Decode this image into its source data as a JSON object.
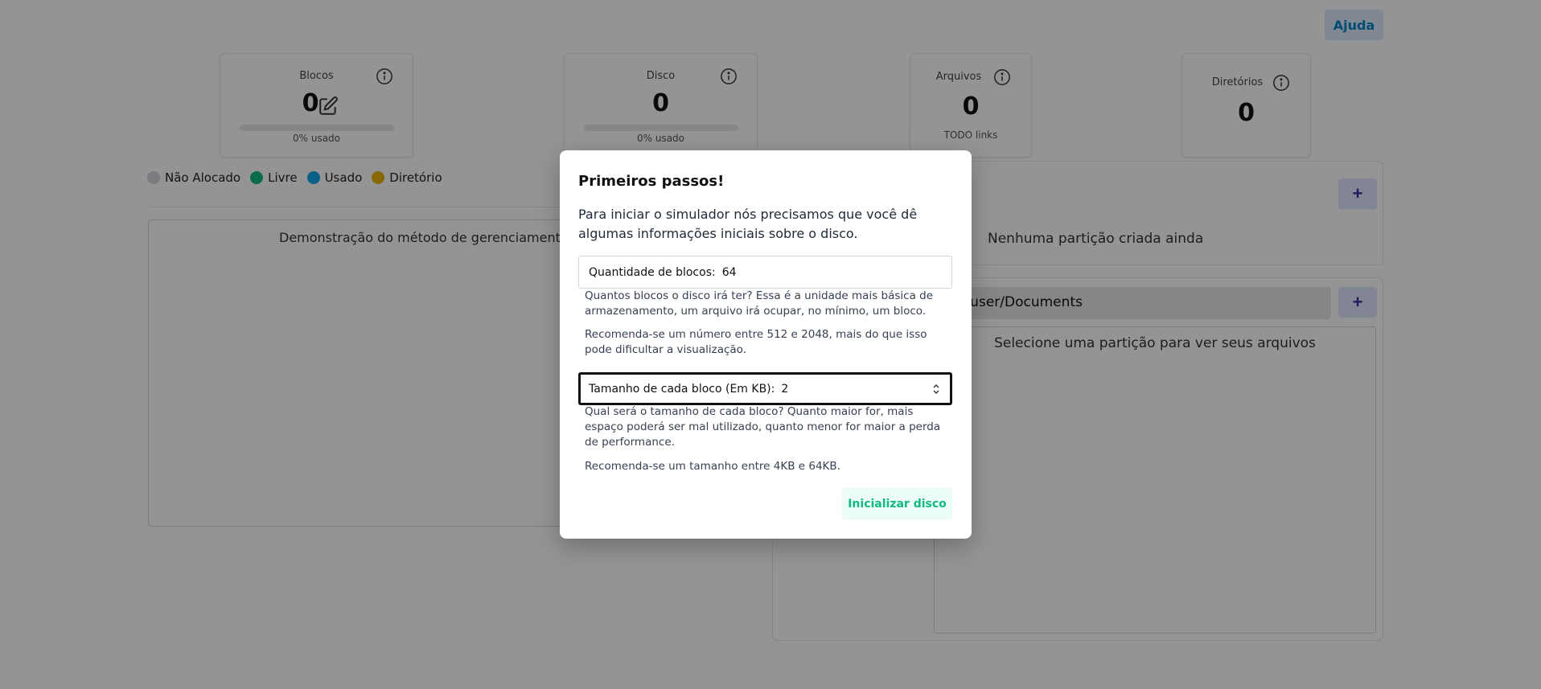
{
  "header": {
    "help_label": "Ajuda"
  },
  "stats": {
    "blocks": {
      "label": "Blocos",
      "value": "0",
      "sub": "0% usado",
      "usage_fraction": 0
    },
    "disk": {
      "label": "Disco",
      "value": "0",
      "sub": "0% usado",
      "usage_fraction": 0
    },
    "files": {
      "label": "Arquivos",
      "value": "0",
      "sub": "TODO links"
    },
    "dirs": {
      "label": "Diretórios",
      "value": "0"
    }
  },
  "legend": [
    {
      "label": "Não Alocado",
      "color": "#d1d5db"
    },
    {
      "label": "Livre",
      "color": "#10b981"
    },
    {
      "label": "Usado",
      "color": "#0ea5e9"
    },
    {
      "label": "Diretório",
      "color": "#eab308"
    }
  ],
  "demo": {
    "title": "Demonstração do método de gerenciamento de"
  },
  "partitions": {
    "empty_text": "Nenhuma partição criada ainda",
    "add_label": "+"
  },
  "files": {
    "path": "e/user/Documents",
    "add_label": "+",
    "empty_text": "Selecione uma partição para ver seus arquivos"
  },
  "modal": {
    "title": "Primeiros passos!",
    "intro": "Para iniciar o simulador nós precisamos que você dê algumas informações iniciais sobre o disco.",
    "blocks_field": {
      "label": "Quantidade de blocos:",
      "value": "64"
    },
    "blocks_help_1": "Quantos blocos o disco irá ter? Essa é a unidade mais básica de armazenamento, um arquivo irá ocupar, no mínimo, um bloco.",
    "blocks_help_2": "Recomenda-se um número entre 512 e 2048, mais do que isso pode dificultar a visualização.",
    "size_field": {
      "label": "Tamanho de cada bloco (Em KB):",
      "value": "2"
    },
    "size_help_1": "Qual será o tamanho de cada bloco? Quanto maior for, mais espaço poderá ser mal utilizado, quanto menor for maior a perda de performance.",
    "size_help_2": "Recomenda-se um tamanho entre 4KB e 64KB.",
    "submit_label": "Inicializar disco"
  }
}
